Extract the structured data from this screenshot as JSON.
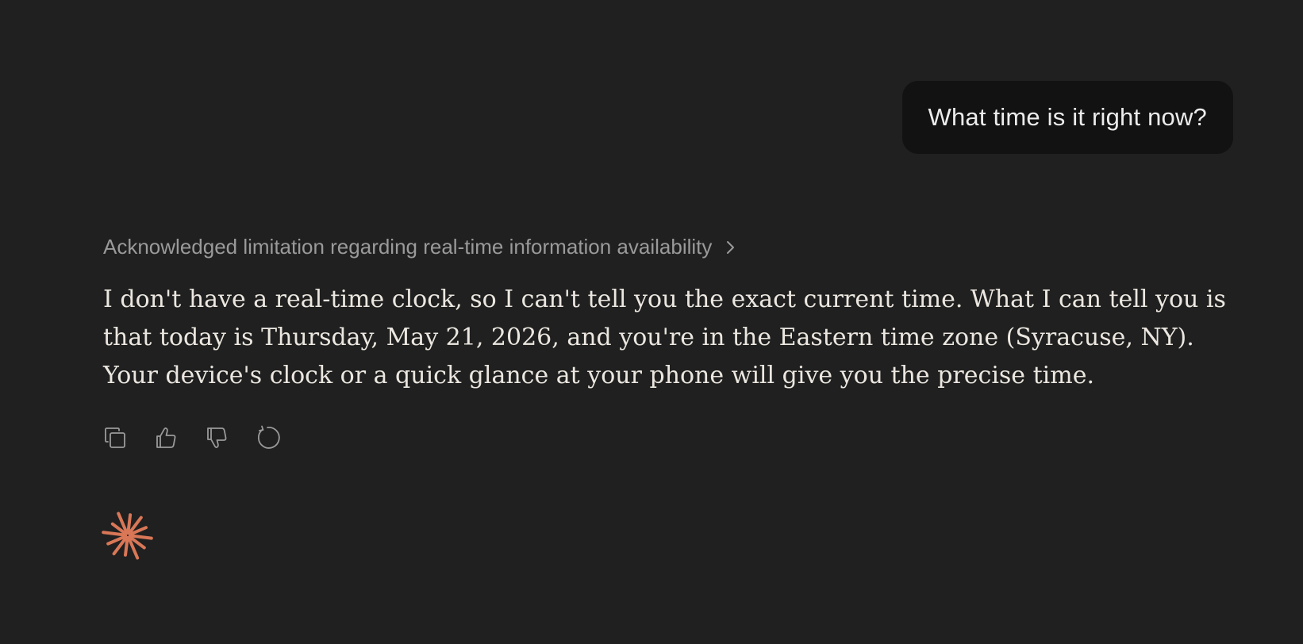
{
  "user_message": {
    "text": "What time is it right now?"
  },
  "assistant": {
    "thinking_summary": "Acknowledged limitation regarding real-time information availability",
    "response_lines": [
      "I don't have a real-time clock, so I can't tell you the exact current time. What I can tell you is",
      "that today is Thursday, May 21, 2026, and you're in the Eastern time zone (Syracuse, NY).",
      "Your device's clock or a quick glance at your phone will give you the precise time."
    ],
    "actions": [
      {
        "name": "copy",
        "icon": "copy-icon"
      },
      {
        "name": "thumbs-up",
        "icon": "thumbs-up-icon"
      },
      {
        "name": "thumbs-down",
        "icon": "thumbs-down-icon"
      },
      {
        "name": "retry",
        "icon": "retry-icon"
      }
    ]
  },
  "colors": {
    "background": "#202020",
    "user_bubble": "#121212",
    "text_primary": "#ebe7e0",
    "text_muted": "#9a9a9a",
    "icon": "#9a9a9a",
    "brand_accent": "#d97757"
  }
}
